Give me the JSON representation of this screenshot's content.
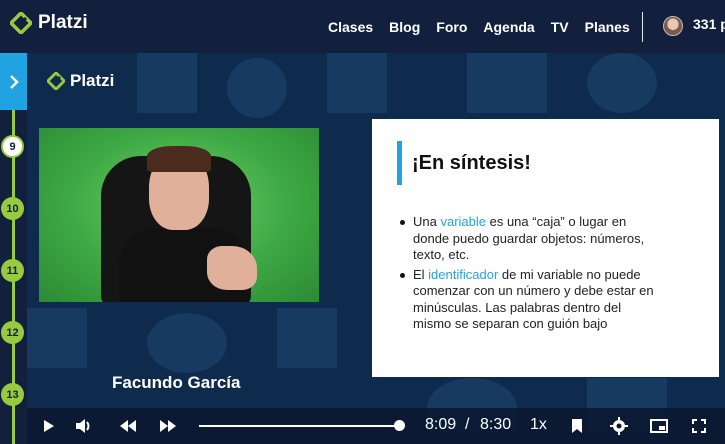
{
  "brand": {
    "name": "Platzi",
    "color": "#98ca3f"
  },
  "nav": {
    "items": [
      "Clases",
      "Blog",
      "Foro",
      "Agenda",
      "TV",
      "Planes"
    ]
  },
  "user": {
    "points": "331 p"
  },
  "timeline": {
    "lessons": [
      {
        "number": "9",
        "state": "current"
      },
      {
        "number": "10",
        "state": "done"
      },
      {
        "number": "11",
        "state": "done"
      },
      {
        "number": "12",
        "state": "done"
      },
      {
        "number": "13",
        "state": "done"
      }
    ]
  },
  "video": {
    "speaker": "Facundo García",
    "watermark": "Platzi",
    "progress": 0.98
  },
  "slide": {
    "title": "¡En síntesis!",
    "bullet1": {
      "pre": "Una ",
      "highlight": "variable",
      "post": " es una “caja” o lugar en donde puedo guardar objetos: números, texto, etc."
    },
    "bullet2": {
      "pre": "El ",
      "highlight": "identificador",
      "post": " de mi variable no puede comenzar con un número y debe estar en minúsculas. Las palabras dentro del mismo se separan con guión bajo"
    }
  },
  "player": {
    "current_time": "8:09",
    "separator": "/",
    "duration": "8:30",
    "speed": "1x"
  }
}
